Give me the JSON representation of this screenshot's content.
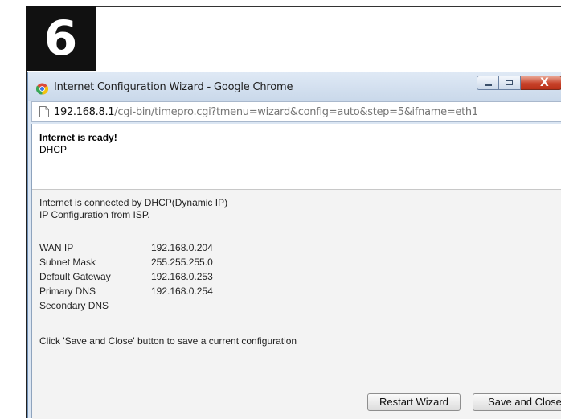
{
  "step_badge": "6",
  "window": {
    "title": "Internet Configuration Wizard - Google Chrome",
    "url_host": "192.168.8.1",
    "url_path": "/cgi-bin/timepro.cgi?tmenu=wizard&config=auto&step=5&ifname=eth1",
    "close_glyph": "X"
  },
  "status": {
    "title": "Internet is ready!",
    "subtitle": "DHCP"
  },
  "message": {
    "line1": "Internet is connected by DHCP(Dynamic IP)",
    "line2": "IP Configuration from ISP."
  },
  "info": [
    {
      "label": "WAN IP",
      "value": "192.168.0.204"
    },
    {
      "label": "Subnet Mask",
      "value": "255.255.255.0"
    },
    {
      "label": "Default Gateway",
      "value": "192.168.0.253"
    },
    {
      "label": "Primary DNS",
      "value": "192.168.0.254"
    },
    {
      "label": "Secondary DNS",
      "value": ""
    }
  ],
  "instruction": "Click 'Save and Close' button to save a current configuration",
  "buttons": {
    "restart": "Restart Wizard",
    "save_close": "Save and Close"
  },
  "icons": {
    "browser": "chrome-icon",
    "page": "page-icon",
    "minimize": "minimize-icon",
    "maximize": "maximize-icon",
    "close": "close-icon"
  }
}
